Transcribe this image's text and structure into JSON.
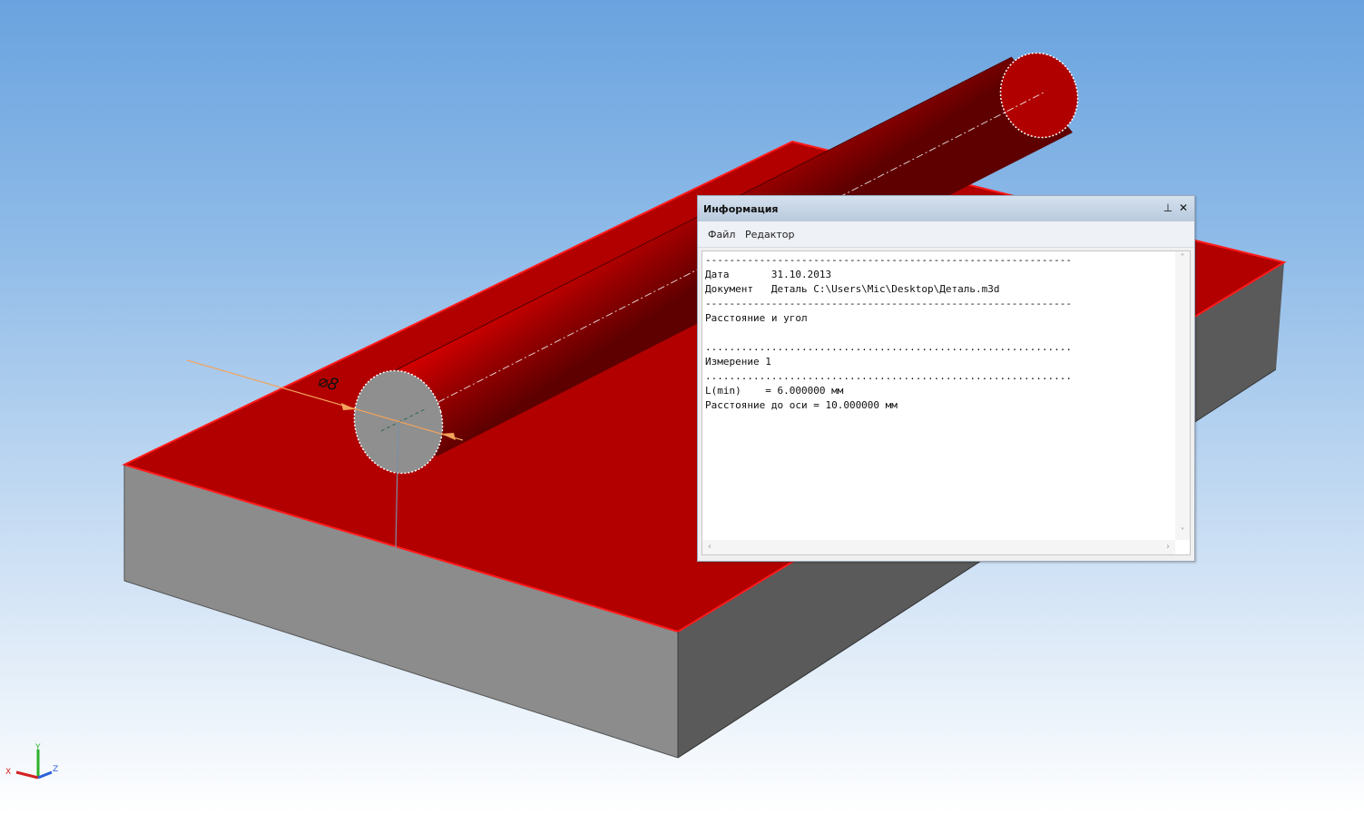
{
  "model": {
    "diameter_label": "⌀8"
  },
  "axes": {
    "x": "X",
    "y": "Y",
    "z": "Z"
  },
  "info_panel": {
    "title": "Информация",
    "pin_symbol": "⊥",
    "close_symbol": "✕",
    "menu": {
      "file": "Файл",
      "editor": "Редактор"
    },
    "text_lines": [
      "-------------------------------------------------------------",
      "Дата       31.10.2013",
      "Документ   Деталь C:\\Users\\Mic\\Desktop\\Деталь.m3d",
      "-------------------------------------------------------------",
      "Расстояние и угол",
      "",
      ".............................................................",
      "Измерение 1",
      ".............................................................",
      "L(min)    = 6.000000 мм",
      "Расстояние до оси = 10.000000 мм"
    ]
  },
  "colors": {
    "face_red": "#b20000",
    "edge_red": "#ff1a1a",
    "side_gray": "#8c8c8c",
    "side_dark": "#5a5a5a",
    "dimension_orange": "#f2a35c"
  }
}
